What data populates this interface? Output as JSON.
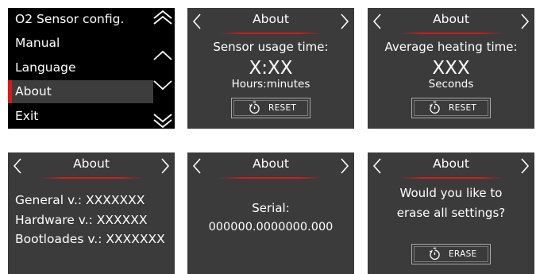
{
  "menu": {
    "items": [
      {
        "label": "O2 Sensor config."
      },
      {
        "label": "Manual"
      },
      {
        "label": "Language"
      },
      {
        "label": "About"
      },
      {
        "label": "Exit"
      }
    ],
    "selected_index": 3
  },
  "usage": {
    "title": "About",
    "heading": "Sensor usage time:",
    "value": "X:XX",
    "unit": "Hours:minutes",
    "button": "RESET"
  },
  "heating": {
    "title": "About",
    "heading": "Average heating time:",
    "value": "XXX",
    "unit": "Seconds",
    "button": "RESET"
  },
  "versions": {
    "title": "About",
    "lines": [
      "General v.: XXXXXXX",
      "Hardware v.: XXXXXX",
      "Bootloades v.: XXXXXXX"
    ]
  },
  "serial": {
    "title": "About",
    "label": "Serial:",
    "value": "000000.0000000.000"
  },
  "erase": {
    "title": "About",
    "question_line1": "Would you like to",
    "question_line2": "erase all settings?",
    "button": "ERASE"
  },
  "colors": {
    "accent": "#e0161a",
    "screen_bg": "#3b3b3b",
    "menu_bg": "#000000"
  },
  "icons": [
    "chevron-left-icon",
    "chevron-right-icon",
    "double-chevron-up-icon",
    "chevron-up-icon",
    "chevron-down-icon",
    "double-chevron-down-icon",
    "stopwatch-reset-icon"
  ]
}
